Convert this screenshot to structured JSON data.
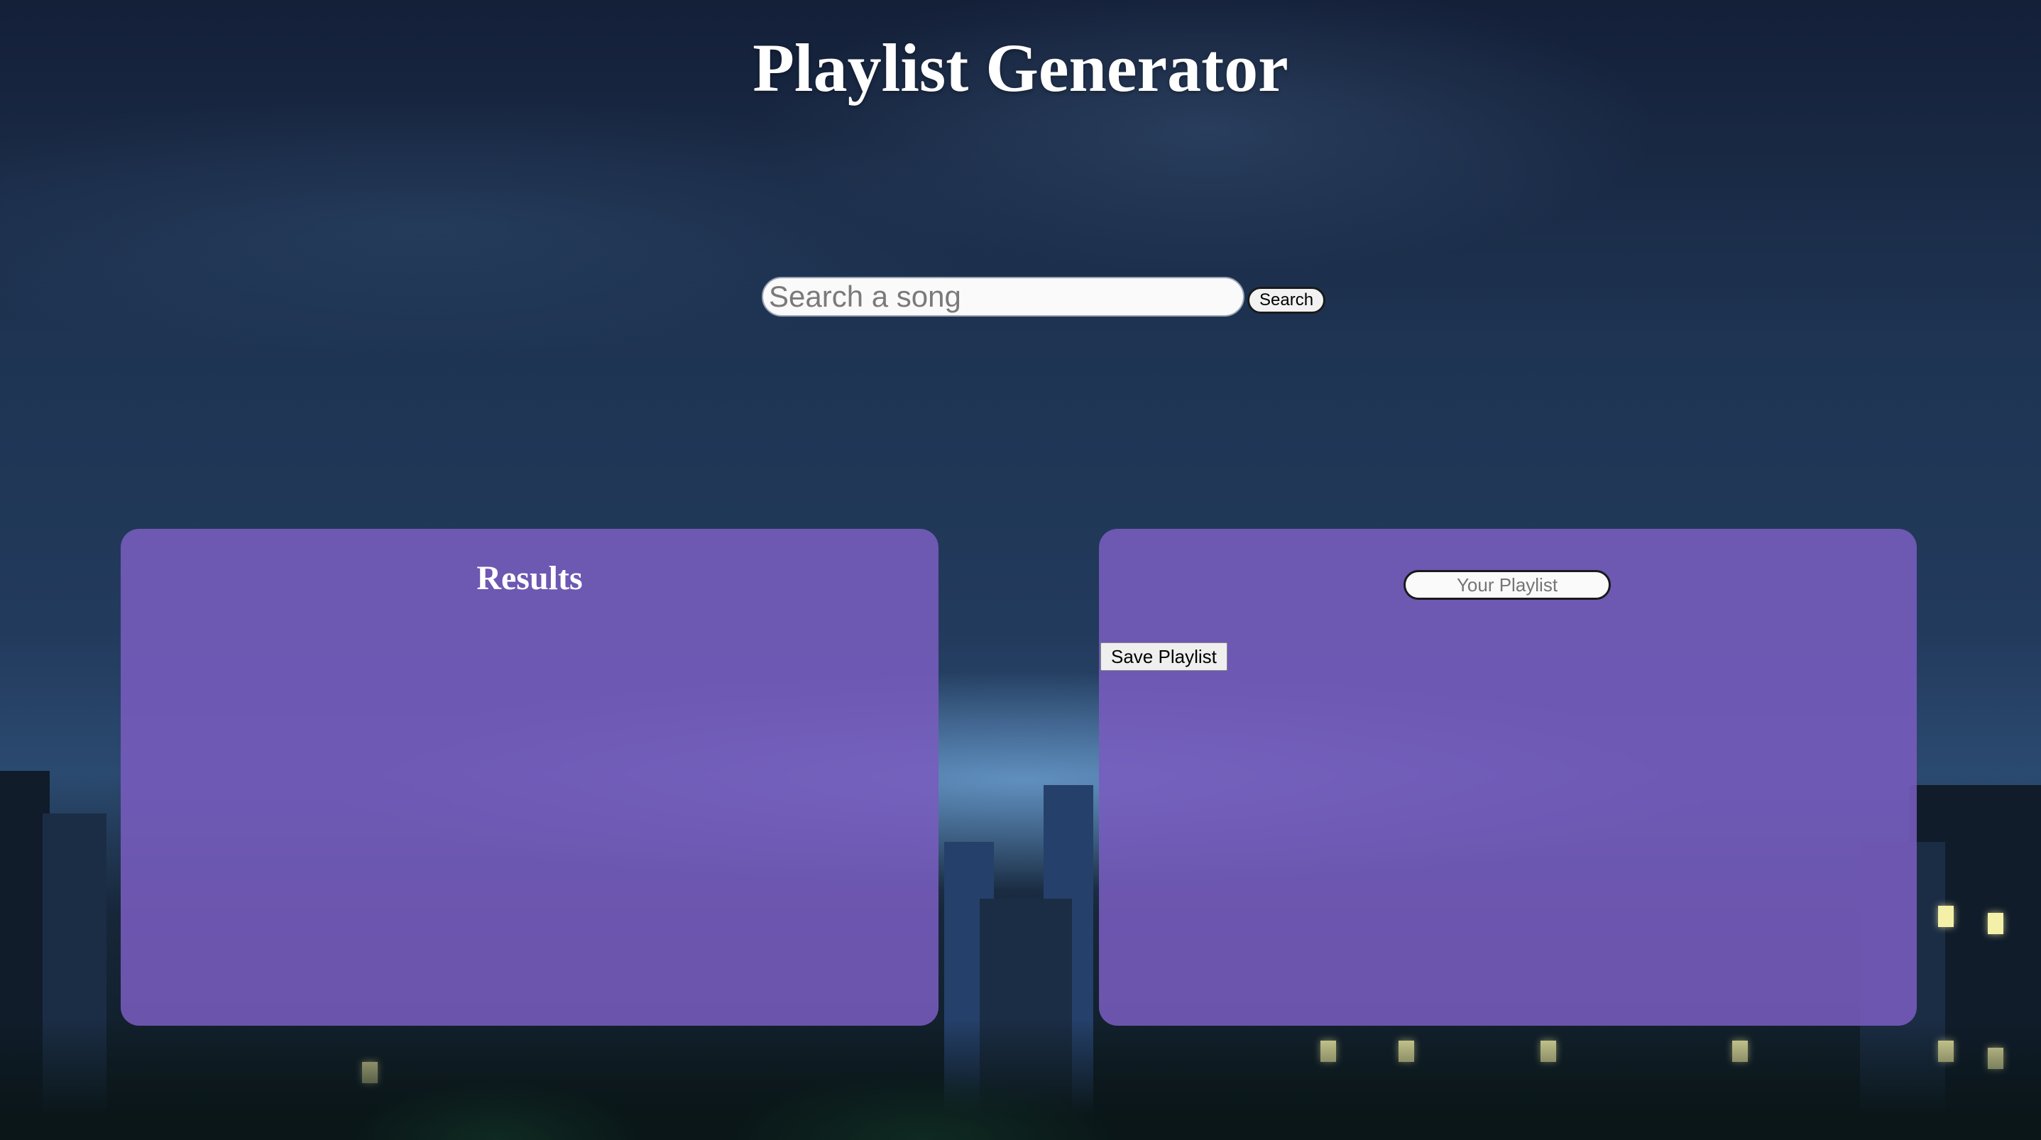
{
  "page": {
    "title": "Playlist Generator"
  },
  "search": {
    "placeholder": "Search a song",
    "value": "",
    "button_label": "Search"
  },
  "results": {
    "title": "Results"
  },
  "playlist": {
    "name_placeholder": "Your Playlist",
    "name_value": "",
    "save_label": "Save Playlist"
  },
  "colors": {
    "panel": "#785cbe",
    "title_text": "#ffffff",
    "background_sky": "#1e3452"
  }
}
